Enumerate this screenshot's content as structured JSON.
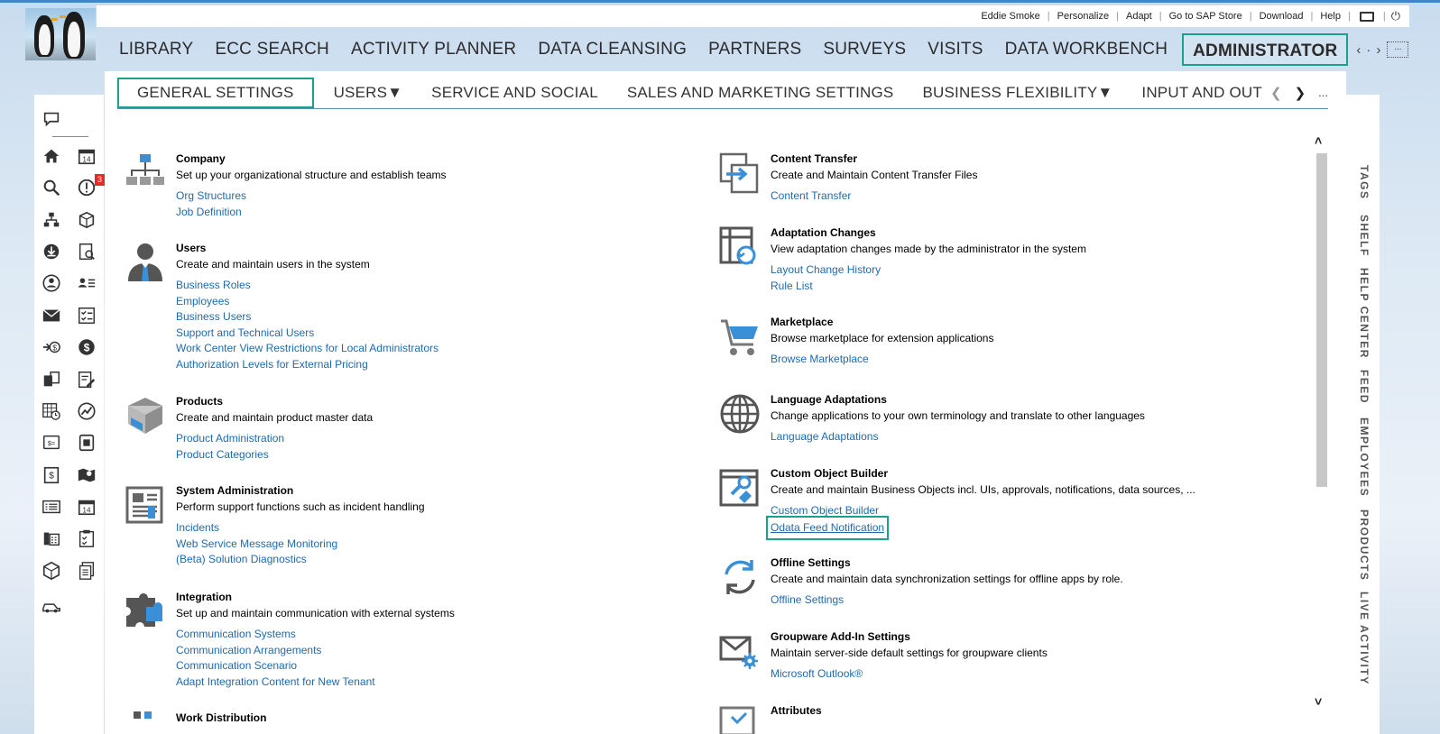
{
  "top_bar": {
    "items": [
      "Eddie Smoke",
      "Personalize",
      "Adapt",
      "Go to SAP Store",
      "Download",
      "Help"
    ]
  },
  "main_nav": {
    "items": [
      "LIBRARY",
      "ECC SEARCH",
      "ACTIVITY PLANNER",
      "DATA CLEANSING",
      "PARTNERS",
      "SURVEYS",
      "VISITS",
      "DATA WORKBENCH",
      "ADMINISTRATOR"
    ],
    "dots": "..."
  },
  "sub_nav": {
    "items": [
      "GENERAL SETTINGS",
      "USERS▼",
      "SERVICE AND SOCIAL",
      "SALES AND MARKETING SETTINGS",
      "BUSINESS FLEXIBILITY▼",
      "INPUT AND OUTPUT MANAGE"
    ],
    "dots": "..."
  },
  "left_rail": {
    "badge": "3",
    "icons": [
      "chat-icon",
      "home-icon",
      "calendar-icon",
      "search-icon",
      "alert-icon",
      "org-chart-icon",
      "box-icon",
      "download-icon",
      "report-icon",
      "person-icon",
      "contacts-icon",
      "mail-icon",
      "checklist-icon",
      "transfer-money-icon",
      "dollar-icon",
      "doc-exchange-icon",
      "edit-doc-icon",
      "calendar-table-icon",
      "growth-icon",
      "billing-icon",
      "tape-icon",
      "price-icon",
      "map-icon",
      "list-icon",
      "calendar-icon",
      "phone-icon",
      "clipboard-icon",
      "cube-icon",
      "docs-icon",
      "car-icon"
    ]
  },
  "left_column": [
    {
      "title": "Company",
      "desc": "Set up your organizational structure and establish teams",
      "links": [
        "Org Structures",
        "Job Definition"
      ],
      "icon": "org-structure-icon"
    },
    {
      "title": "Users",
      "desc": "Create and maintain users in the system",
      "links": [
        "Business Roles",
        "Employees",
        "Business Users",
        "Support and Technical Users",
        "Work Center View Restrictions for Local Administrators",
        "Authorization Levels for External Pricing"
      ],
      "icon": "user-icon"
    },
    {
      "title": "Products",
      "desc": "Create and maintain product master data",
      "links": [
        "Product Administration",
        "Product Categories"
      ],
      "icon": "product-box-icon"
    },
    {
      "title": "System Administration",
      "desc": "Perform support functions such as incident handling",
      "links": [
        "Incidents",
        "Web Service Message Monitoring",
        "(Beta) Solution Diagnostics"
      ],
      "icon": "system-admin-icon"
    },
    {
      "title": "Integration",
      "desc": "Set up and maintain communication with external systems",
      "links": [
        "Communication Systems",
        "Communication Arrangements",
        "Communication Scenario",
        "Adapt Integration Content for New Tenant"
      ],
      "icon": "puzzle-icon"
    },
    {
      "title": "Work Distribution",
      "desc": "",
      "links": [],
      "icon": "work-distribution-icon"
    }
  ],
  "right_column": [
    {
      "title": "Content Transfer",
      "desc": "Create and Maintain Content Transfer Files",
      "links": [
        "Content Transfer"
      ],
      "icon": "content-transfer-icon"
    },
    {
      "title": "Adaptation Changes",
      "desc": "View adaptation changes made by the administrator in the system",
      "links": [
        "Layout Change History",
        "Rule List"
      ],
      "icon": "adaptation-icon"
    },
    {
      "title": "Marketplace",
      "desc": "Browse marketplace for extension applications",
      "links": [
        "Browse Marketplace"
      ],
      "icon": "cart-icon"
    },
    {
      "title": "Language Adaptations",
      "desc": "Change applications to your own terminology and translate to other languages",
      "links": [
        "Language Adaptations"
      ],
      "icon": "globe-icon"
    },
    {
      "title": "Custom Object Builder",
      "desc": "Create and maintain Business Objects incl. UIs, approvals, notifications, data sources, ...",
      "links": [
        "Custom Object Builder",
        "Odata Feed Notification"
      ],
      "icon": "custom-object-icon"
    },
    {
      "title": "Offline Settings",
      "desc": "Create and maintain data synchronization settings for offline apps by role.",
      "links": [
        "Offline Settings"
      ],
      "icon": "sync-icon"
    },
    {
      "title": "Groupware Add-In Settings",
      "desc": "Maintain server-side default settings for groupware clients",
      "links": [
        "Microsoft Outlook®"
      ],
      "icon": "mail-gear-icon"
    },
    {
      "title": "Attributes",
      "desc": "",
      "links": [],
      "icon": "attributes-icon"
    }
  ],
  "right_rail": [
    "TAGS",
    "SHELF",
    "HELP CENTER",
    "FEED",
    "EMPLOYEES",
    "PRODUCTS",
    "LIVE ACTIVITY"
  ],
  "colors": {
    "accent_outline": "#18a28b",
    "link": "#1f6aaf",
    "header_top": "#3f87c8"
  }
}
